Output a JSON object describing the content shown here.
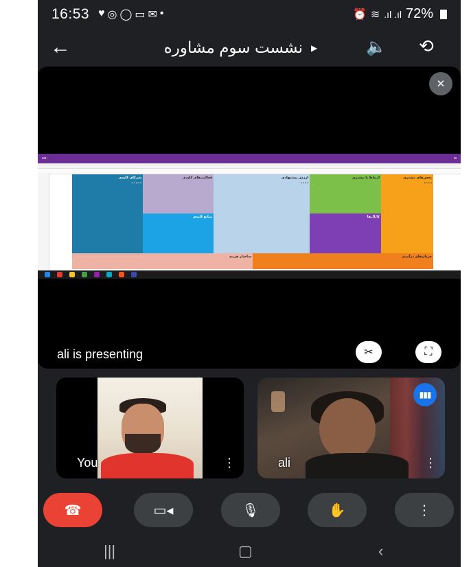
{
  "status_bar": {
    "time": "16:53",
    "left_icons": [
      "heart-icon",
      "circle-app-icon",
      "whatsapp-icon",
      "video-icon",
      "mail-icon",
      "dot-icon"
    ],
    "right_text": "72%",
    "right_icons": [
      "alarm-icon",
      "wifi-icon",
      "volte-icon",
      "signal-icon",
      "battery-icon"
    ]
  },
  "header": {
    "title": "نشست سوم مشاوره"
  },
  "presentation": {
    "presenting_label": "ali is presenting",
    "blocks": {
      "partners": "شرکای کلیدی",
      "activities": "فعالیت‌های کلیدی",
      "value": "ارزش پیشنهادی",
      "relationships": "ارتباط با مشتری",
      "segments": "بخش‌های مشتری",
      "resources": "منابع کلیدی",
      "channels": "کانال‌ها",
      "costs": "ساختار هزینه",
      "revenue": "جریان‌های درآمدی"
    }
  },
  "participants": [
    {
      "name": "You"
    },
    {
      "name": "ali"
    }
  ],
  "colors": {
    "end_call": "#ea4335",
    "speaking": "#1a73e8",
    "control_bg": "#3c4043"
  }
}
